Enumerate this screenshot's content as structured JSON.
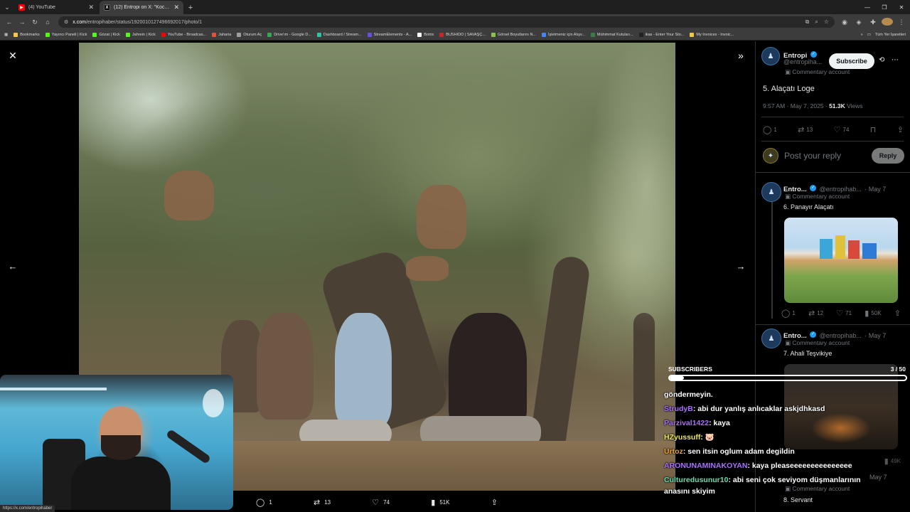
{
  "browser": {
    "tabs": [
      {
        "title": "(4) YouTube",
        "favicon": "youtube-icon",
        "active": false
      },
      {
        "title": "(12) Entropi on X: \"Kocası vatan",
        "favicon": "x-icon",
        "active": true
      }
    ],
    "url": {
      "host": "x.com",
      "path": "/entropihaber/status/1920010127496692017/photo/1"
    },
    "bookmarks": [
      {
        "label": "Bookmarks",
        "color": "#f5c842"
      },
      {
        "label": "Yayıncı Paneli | Kick",
        "color": "#53fc18"
      },
      {
        "label": "Gözat | Kick",
        "color": "#53fc18"
      },
      {
        "label": "Jahrein | Kick",
        "color": "#53fc18"
      },
      {
        "label": "YouTube - Broadcas...",
        "color": "#ff0000"
      },
      {
        "label": "Jaharia",
        "color": "#e2533a"
      },
      {
        "label": "Oturum Aç",
        "color": "#9aa0a6"
      },
      {
        "label": "Drive'ım - Google D...",
        "color": "#34a853"
      },
      {
        "label": "Dashboard / Stream...",
        "color": "#31c3a2"
      },
      {
        "label": "StreamElements - A...",
        "color": "#6b4de6"
      },
      {
        "label": "Botrix",
        "color": "#ffffff"
      },
      {
        "label": "BUSHIDO | SAVAŞÇ...",
        "color": "#c62828"
      },
      {
        "label": "Görsel Boyutlarını N...",
        "color": "#8bc34a"
      },
      {
        "label": "İşletmeniz için Alışv...",
        "color": "#4285f4"
      },
      {
        "label": "Mühimmat Kutuları...",
        "color": "#3a7d44"
      },
      {
        "label": "ikas - Enter Your Sto...",
        "color": "#222222"
      },
      {
        "label": "My Invoices - Invoic...",
        "color": "#f2c744"
      }
    ],
    "all_bookmarks_label": "Tüm Yer İşaretleri",
    "status_url": "https://x.com/entropihaber"
  },
  "photo_actions": {
    "replies": "1",
    "reposts": "13",
    "likes": "74",
    "views": "51K"
  },
  "sidebar": {
    "author": {
      "name": "Entropi",
      "handle": "@entropiha...",
      "label": "Commentary account",
      "subscribe": "Subscribe"
    },
    "post": {
      "text": "5. Alaçatı Loge",
      "time": "9:57 AM · May 7, 2025 · ",
      "views": "51.3K",
      "views_label": " Views"
    },
    "actions": {
      "replies": "1",
      "reposts": "13",
      "likes": "74"
    },
    "reply_placeholder": "Post your reply",
    "reply_button": "Reply",
    "replies": [
      {
        "name": "Entro...",
        "handle": "@entropihab...",
        "date": "· May 7",
        "label": "Commentary account",
        "text": "6. Panayır Alaçatı",
        "stats": {
          "replies": "1",
          "reposts": "12",
          "likes": "71",
          "views": "50K"
        }
      },
      {
        "name": "Entro...",
        "handle": "@entropihab...",
        "date": "· May 7",
        "label": "Commentary account",
        "text": "7. Ahali Teşvikiye",
        "stats": {
          "replies": "",
          "reposts": "",
          "likes": "",
          "views": "49K"
        }
      },
      {
        "name": "",
        "handle": "",
        "date": "May 7",
        "label": "Commentary account",
        "text": "8. Servant"
      }
    ]
  },
  "overlay": {
    "sub_goal": {
      "label": "SUBSCRIBERS",
      "current": "3",
      "goal": "50",
      "count_text": "3 / 50",
      "progress": 0.06
    },
    "chat": [
      {
        "user": "",
        "color": "#ffffff",
        "message": "göndermeyin."
      },
      {
        "user": "StrudyB",
        "color": "#a970ff",
        "message": ": abi dur yanlış anlıcaklar askjdhkasd"
      },
      {
        "user": "Parzival1422",
        "color": "#a970ff",
        "message": ": kaya"
      },
      {
        "user": "HZyussuff",
        "color": "#e8e85a",
        "message": ": 🐷"
      },
      {
        "user": "Urtoz",
        "color": "#f0a030",
        "message": ": sen itsin oglum adam degildin"
      },
      {
        "user": "ARONUNAMINAKOYAN",
        "color": "#a970ff",
        "message": ": kaya pleaseeeeeeeeeeeeeee"
      },
      {
        "user": "Culturedusunur10",
        "color": "#5ee0b0",
        "message": ": abi seni çok seviyom düşmanlarının anasını skiyim"
      }
    ]
  }
}
